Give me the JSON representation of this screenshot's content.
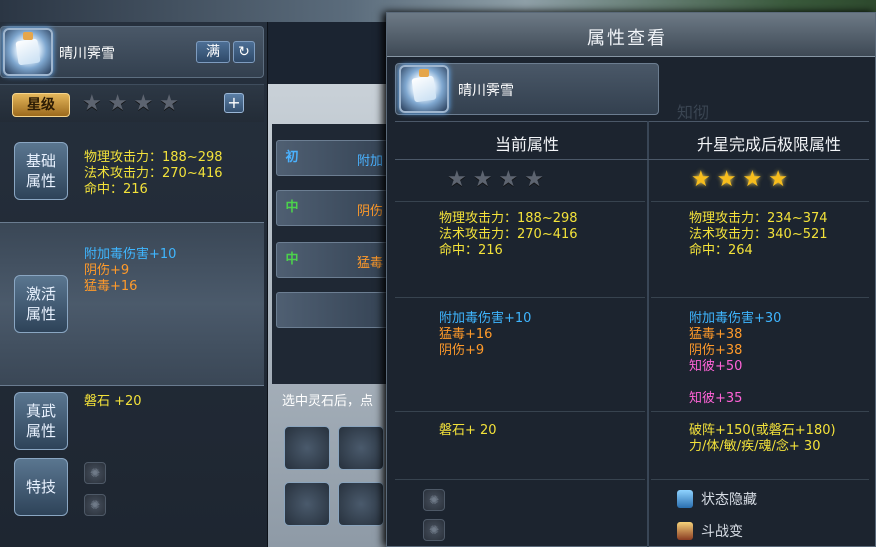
{
  "character": {
    "name": "晴川霁雪"
  },
  "left_panel": {
    "max_label": "满",
    "refresh_icon": "↻",
    "star_level_label": "星级",
    "stars_filled": 0,
    "stars_total": 4,
    "add_label": "+",
    "basic": {
      "label": "基础属性",
      "lines": [
        "物理攻击力：188~298",
        "法术攻击力：270~416",
        "命中：216"
      ]
    },
    "activated": {
      "label": "激活属性",
      "lines": [
        {
          "text": "附加毒伤害+10",
          "color": "blue"
        },
        {
          "text": "阴伤+9",
          "color": "orange"
        },
        {
          "text": "猛毒+16",
          "color": "orange"
        }
      ]
    },
    "true_martial": {
      "label": "真武属性",
      "value": "磐石 +20"
    },
    "special": {
      "label": "特技"
    }
  },
  "middle_panel": {
    "rows": [
      {
        "tag": "初",
        "text": "附加",
        "tag_color": "#4ab2ff",
        "text_color": "#4ab2ff"
      },
      {
        "tag": "中",
        "text": "阴伤",
        "tag_color": "#4cd24c",
        "text_color": "#ff9a2a"
      },
      {
        "tag": "中",
        "text": "猛毒",
        "tag_color": "#4cd24c",
        "text_color": "#ff9a2a"
      },
      {
        "tag": "",
        "text": "",
        "tag_color": "#ffffff",
        "text_color": "#ffffff"
      }
    ],
    "tip": "选中灵石后，点"
  },
  "attr_panel": {
    "title": "属性查看",
    "ghost_text": "知彻",
    "current_header": "当前属性",
    "limit_header": "升星完成后极限属性",
    "current": {
      "stars_filled": 0,
      "stars_total": 4,
      "base": [
        "物理攻击力：188~298",
        "法术攻击力：270~416",
        "命中：216"
      ],
      "activated": [
        {
          "text": "附加毒伤害+10",
          "color": "blue"
        },
        {
          "text": "猛毒+16",
          "color": "orange"
        },
        {
          "text": "阴伤+9",
          "color": "orange"
        }
      ],
      "true_martial": "磐石+ 20"
    },
    "limit": {
      "stars_filled": 4,
      "stars_total": 4,
      "base": [
        "物理攻击力：234~374",
        "法术攻击力：340~521",
        "命中：264"
      ],
      "activated": [
        {
          "text": "附加毒伤害+30",
          "color": "blue"
        },
        {
          "text": "猛毒+38",
          "color": "orange"
        },
        {
          "text": "阴伤+38",
          "color": "orange"
        },
        {
          "text": "知彼+50",
          "color": "pink"
        }
      ],
      "extra": {
        "text": "知彼+35",
        "color": "pink"
      },
      "true_martial": [
        "破阵+150(或磐石+180)",
        "力/体/敏/疾/魂/念+ 30"
      ]
    },
    "status_items": [
      "状态隐藏",
      "斗战变"
    ]
  }
}
